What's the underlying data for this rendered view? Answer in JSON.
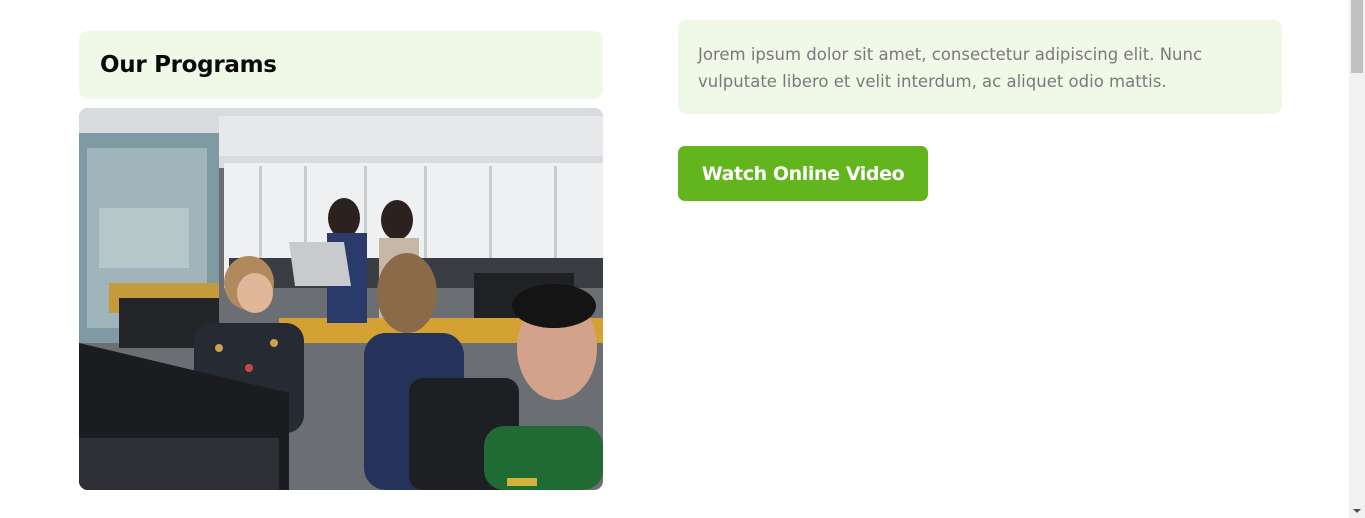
{
  "programs": {
    "title": "Our Programs"
  },
  "image": {
    "icon": "office-photo-icon"
  },
  "description": {
    "text": "Jorem ipsum dolor sit amet, consectetur adipiscing elit. Nunc vulputate libero et velit interdum, ac aliquet odio mattis."
  },
  "cta": {
    "label": "Watch Online Video"
  },
  "colors": {
    "accent": "#62b51c",
    "card_background": "#f0f8e8",
    "body_text": "#7a7a7a",
    "heading_text": "#0b0b0b"
  }
}
